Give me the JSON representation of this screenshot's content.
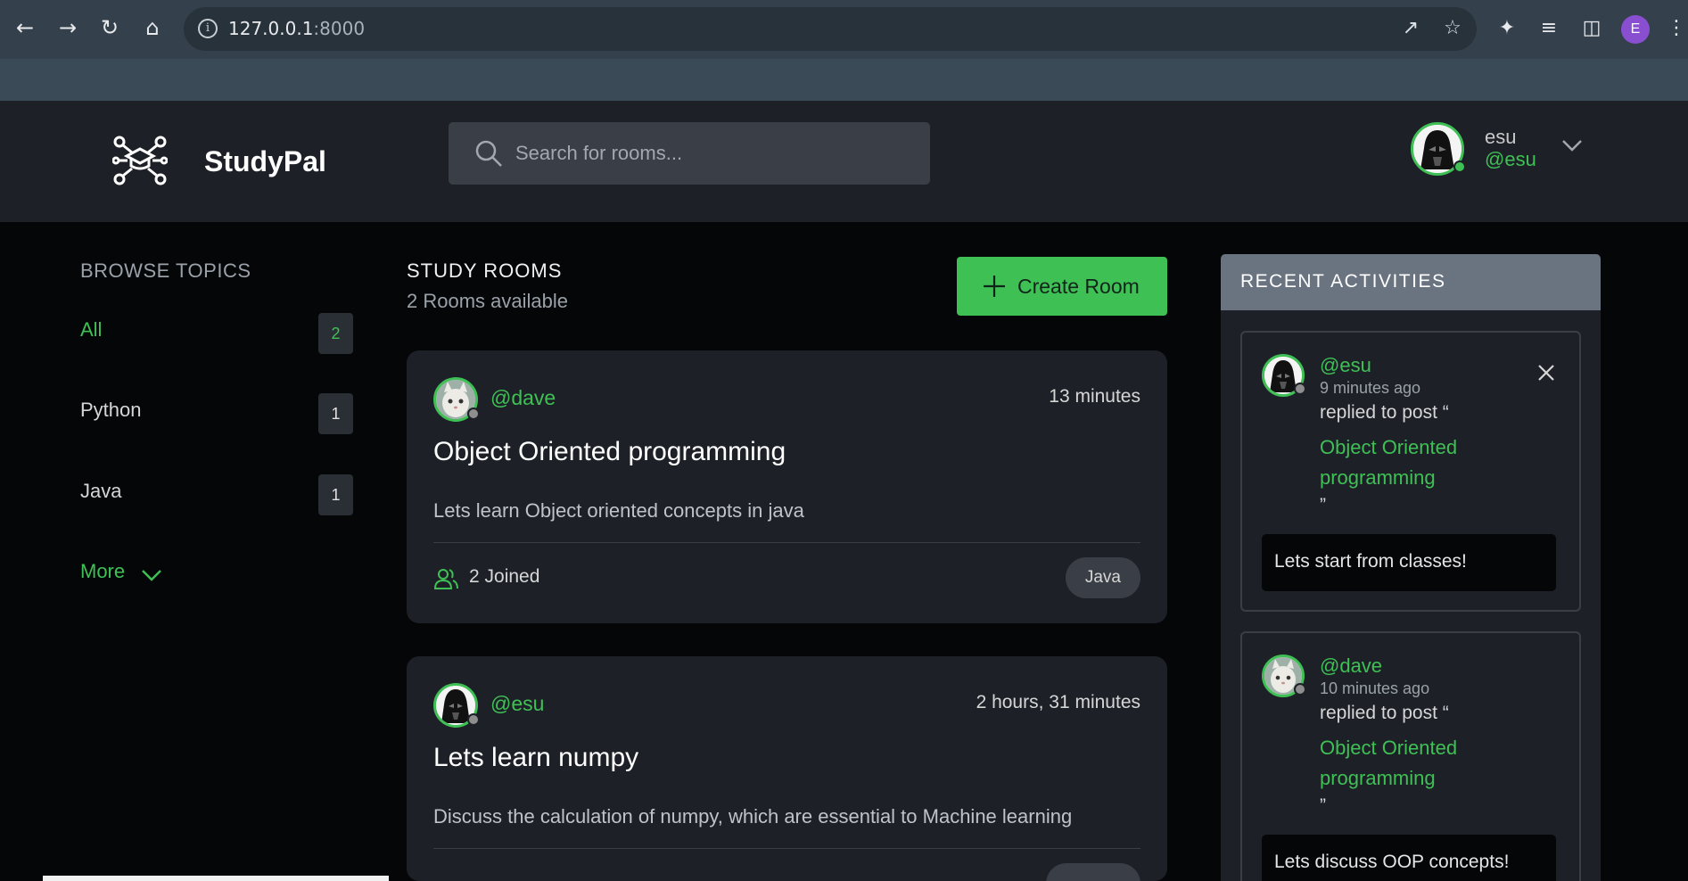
{
  "browser": {
    "url_host": "127.0.0.1",
    "url_port": ":8000",
    "profile_initial": "E",
    "accent": "#8a4fd1"
  },
  "app": {
    "brand": "StudyPal",
    "search_placeholder": "Search for rooms...",
    "user": {
      "name": "esu",
      "handle": "@esu"
    },
    "accent": "#3fc055"
  },
  "sidebar": {
    "title": "BROWSE TOPICS",
    "topics": [
      {
        "label": "All",
        "count": "2"
      },
      {
        "label": "Python",
        "count": "1"
      },
      {
        "label": "Java",
        "count": "1"
      }
    ],
    "more": "More"
  },
  "main": {
    "title": "STUDY ROOMS",
    "count_text": "2 Rooms available",
    "create_label": "Create Room",
    "rooms": [
      {
        "host": "@dave",
        "time": "13 minutes",
        "title": "Object Oriented programming",
        "description": "Lets learn Object oriented concepts in java",
        "joined": "2 Joined",
        "tag": "Java"
      },
      {
        "host": "@esu",
        "time": "2 hours, 31 minutes",
        "title": "Lets learn numpy",
        "description": "Discuss the calculation of numpy, which are essential to Machine learning"
      }
    ]
  },
  "activities": {
    "title": "RECENT ACTIVITIES",
    "items": [
      {
        "user": "@esu",
        "time": "9 minutes ago",
        "action": "replied to post “",
        "post": "Object Oriented programming",
        "quote_end": "”",
        "message": "Lets start from classes!"
      },
      {
        "user": "@dave",
        "time": "10 minutes ago",
        "action": "replied to post “",
        "post": "Object Oriented programming",
        "quote_end": "”",
        "message": "Lets discuss OOP concepts!"
      }
    ]
  }
}
